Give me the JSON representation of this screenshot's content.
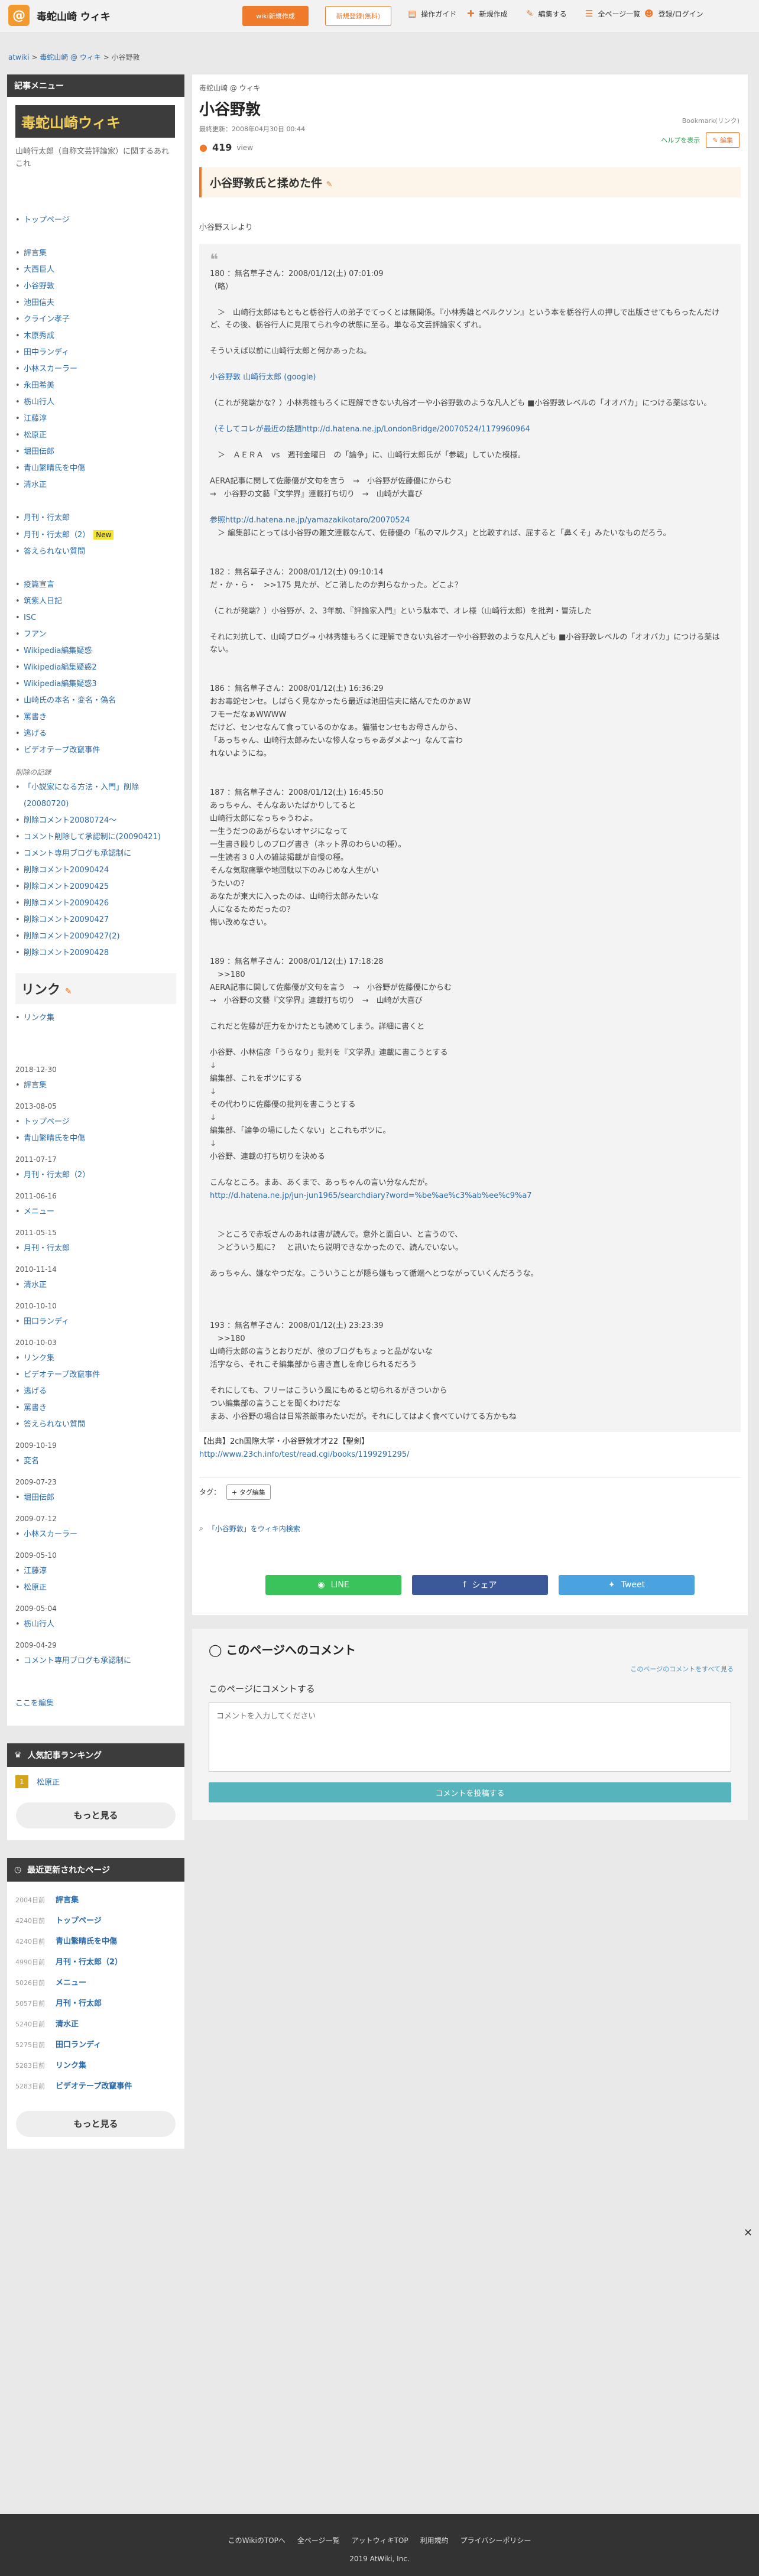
{
  "topbar": {
    "logo_letter": "@",
    "site_title": "毒蛇山崎 ウィキ",
    "wiki_button": "wiki新規作成",
    "login_button": "新規登録(無料)",
    "nav": [
      "操作ガイド",
      "新規作成",
      "編集する",
      "全ページ一覧",
      "登録/ログイン"
    ]
  },
  "breadcrumb": [
    "atwiki",
    "毒蛇山崎 @ ウィキ",
    "小谷野敦"
  ],
  "sidebar": {
    "menu_head": "記事メニュー",
    "wiki_title": "毒蛇山崎ウィキ",
    "desc": "山崎行太郎（自称文芸評論家）に関するあれこれ",
    "nav1": [
      "トップページ"
    ],
    "nav2": [
      "評言集",
      "大西巨人",
      "小谷野敦",
      "池田信夫",
      "クライン孝子",
      "木原秀成",
      "田中ランディ",
      "小林スカーラー",
      "永田希美",
      "栃山行人",
      "江藤淳",
      "松原正",
      "堀田伝郎",
      "青山繁晴氏を中傷",
      "清水正"
    ],
    "nav3": [
      "月刊・行太郎",
      "月刊・行太郎（2）",
      "答えられない質問"
    ],
    "new_badge": "New",
    "nav4": [
      "疫篇宣言",
      "筑紫人日記",
      "ISC",
      "フアン",
      "Wikipedia編集疑惑",
      "Wikipedia編集疑惑2",
      "Wikipedia編集疑惑3",
      "山崎氏の本名・変名・偽名",
      "罵書き",
      "逃げる",
      "ビデオテープ改竄事件"
    ],
    "deleted_head": "削除の記録",
    "nav5": [
      "「小説家になる方法・入門」削除(20080720)",
      "削除コメント20080724〜",
      "コメント削除して承認制に(20090421)",
      "コメント専用ブログも承認制に",
      "削除コメント20090424",
      "削除コメント20090425",
      "削除コメント20090426",
      "削除コメント20090427",
      "削除コメント20090427(2)",
      "削除コメント20090428"
    ],
    "links_title": "リンク",
    "links": [
      "リンク集"
    ],
    "history": [
      {
        "date": "2018-12-30",
        "items": [
          "評言集"
        ]
      },
      {
        "date": "2013-08-05",
        "items": [
          "トップページ",
          "青山繁晴氏を中傷"
        ]
      },
      {
        "date": "2011-07-17",
        "items": [
          "月刊・行太郎（2）"
        ]
      },
      {
        "date": "2011-06-16",
        "items": [
          "メニュー"
        ]
      },
      {
        "date": "2011-05-15",
        "items": [
          "月刊・行太郎"
        ]
      },
      {
        "date": "2010-11-14",
        "items": [
          "清水正"
        ]
      },
      {
        "date": "2010-10-10",
        "items": [
          "田口ランディ"
        ]
      },
      {
        "date": "2010-10-03",
        "items": [
          "リンク集",
          "ビデオテープ改竄事件",
          "逃げる",
          "罵書き",
          "答えられない質問"
        ]
      },
      {
        "date": "2009-10-19",
        "items": [
          "変名"
        ]
      },
      {
        "date": "2009-07-23",
        "items": [
          "堀田伝郎"
        ]
      },
      {
        "date": "2009-07-12",
        "items": [
          "小林スカーラー"
        ]
      },
      {
        "date": "2009-05-10",
        "items": [
          "江藤淳",
          "松原正"
        ]
      },
      {
        "date": "2009-05-04",
        "items": [
          "栃山行人"
        ]
      },
      {
        "date": "2009-04-29",
        "items": [
          "コメント専用ブログも承認制に"
        ]
      }
    ],
    "edit_here": "ここを編集",
    "rank_head": "人気記事ランキング",
    "rank": [
      {
        "num": "1",
        "title": "松原正"
      }
    ],
    "more": "もっと見る",
    "recent_head": "最近更新されたページ",
    "recent": [
      {
        "ago": "2004日前",
        "title": "評言集"
      },
      {
        "ago": "4240日前",
        "title": "トップページ"
      },
      {
        "ago": "4240日前",
        "title": "青山繁晴氏を中傷"
      },
      {
        "ago": "4990日前",
        "title": "月刊・行太郎（2）"
      },
      {
        "ago": "5026日前",
        "title": "メニュー"
      },
      {
        "ago": "5057日前",
        "title": "月刊・行太郎"
      },
      {
        "ago": "5240日前",
        "title": "清水正"
      },
      {
        "ago": "5275日前",
        "title": "田口ランディ"
      },
      {
        "ago": "5283日前",
        "title": "リンク集"
      },
      {
        "ago": "5283日前",
        "title": "ビデオテープ改竄事件"
      }
    ],
    "more2": "もっと見る"
  },
  "page": {
    "sub": "毒蛇山崎 @ ウィキ",
    "title": "小谷野敦",
    "updated": "最終更新：2008年04月30日 00:44",
    "views": "419",
    "views_label": "view",
    "meta": "Bookmark(リンク)",
    "help": "ヘルプを表示",
    "edit": "編集",
    "section_title": "小谷野敦氏と揉めた件",
    "intro": "小谷野スレより",
    "quote": [
      "180 ：無名草子さん：2008/01/12(土) 07:01:09",
      "（略）",
      "",
      "　＞　山崎行太郎はもともと栃谷行人の弟子でてっくとは無関係。『小林秀雄とベルクソン』という本を栃谷行人の押しで出版させてもらったんだけど、その後、栃谷行人に見限てられ今の状態に至る。単なる文芸評論家くずれ。",
      "",
      "そういえば以前に山崎行太郎と何かあったね。",
      "",
      "小谷野敦 山崎行太郎 (google)",
      "",
      "（これが発端かな？）小林秀雄もろくに理解できない丸谷才一や小谷野敦のような凡人ども ■小谷野敦レベルの「オオバカ」につける薬はない。",
      "",
      "（そしてコレが最近の話題http://d.hatena.ne.jp/LondonBridge/20070524/1179960964",
      "",
      "　＞　ＡＥＲＡ　vs　週刊金曜日　の「論争」に、山崎行太郎氏が「参戦」していた模様。",
      "",
      "AERA記事に関して佐藤優が文句を言う　→　小谷野が佐藤優にからむ",
      "→　小谷野の文藝『文学界』連載打ち切り　→　山崎が大喜び",
      "",
      "参照http://d.hatena.ne.jp/yamazakikotaro/20070524",
      "　＞ 編集部にとっては小谷野の難文連載なんて、佐藤優の「私のマルクス」と比較すれば、屁すると「鼻くそ」みたいなものだろう。",
      "",
      "",
      "182 ：無名草子さん：2008/01/12(土) 09:10:14",
      "だ・か・ら・　>>175 見たが、どこ消したのか判らなかった。どこよ？",
      "",
      "（これが発端？）小谷野が、2、3年前、『評論家入門』という駄本で、オレ様（山崎行太郎）を批判・冒涜した",
      "",
      "それに対抗して、山崎ブログ→ 小林秀雄もろくに理解できない丸谷才一や小谷野敦のような凡人ども ■小谷野敦レベルの「オオバカ」につける薬はない。",
      "",
      "",
      "186 ：無名草子さん：2008/01/12(土) 16:36:29",
      "おお毒蛇センセ。しばらく見なかったら最近は池田信夫に絡んでたのかぁW",
      "フモーだなぁWWWW",
      "だけど、センセなんて食っているのかなぁ。猫猫センセもお母さんから、",
      "「あっちゃん、山崎行太郎みたいな惨人なっちゃあダメよ～」なんて言わ",
      "れないようにね。",
      "",
      "",
      "187 ：無名草子さん：2008/01/12(土) 16:45:50",
      "あっちゃん、そんなあいたばかりしてると",
      "山崎行太郎になっちゃうわよ。",
      "一生うだつのあがらないオヤジになって",
      "一生書き殴りしのブログ書き（ネット界のわらいの種）。",
      "一生読者３０人の雑誌掲載が自慢の種。",
      "そんな気取痛撃や地団駄以下のみじめな人生がい",
      "うたいの？",
      "あなたが東大に入ったのは、山崎行太郎みたいな",
      "人になるためだったの？",
      "悔い改めなさい。",
      "",
      "",
      "189 ：無名草子さん：2008/01/12(土) 17:18:28",
      "　>>180",
      "AERA記事に関して佐藤優が文句を言う　→　小谷野が佐藤優にからむ",
      "→　小谷野の文藝『文学界』連載打ち切り　→　山崎が大喜び",
      "",
      "これだと佐藤が圧力をかけたとも読めてしまう。詳細に書くと",
      "",
      "小谷野、小林信彦「うらなり」批判を『文学界』連載に書こうとする",
      "↓",
      "編集部、これをボツにする",
      "↓",
      "その代わりに佐藤優の批判を書こうとする",
      "↓",
      "編集部、「論争の場にしたくない」とこれもボツに。",
      "↓",
      "小谷野、連載の打ち切りを決める",
      "",
      "こんなところ。まあ、あくまで、あっちゃんの言い分なんだが。",
      "http://d.hatena.ne.jp/jun-jun1965/searchdiary?word=%be%ae%c3%ab%ee%c9%a7",
      "",
      "",
      "　＞ところで赤坂さんのあれは書が読んで。意外と面白い、と言うので、",
      "　＞どういう風に？　と訊いたら説明できなかったので、読んでいない。",
      "",
      "あっちゃん、嫌なやつだな。こういうことが隠ら嫌もって循端へとつながっていくんだろうな。",
      "",
      "",
      "",
      "193 ：無名草子さん：2008/01/12(土) 23:23:39",
      "　>>180",
      "山崎行太郎の言うとおりだが、彼のブログもちょっと品がないな",
      "活字なら、それこそ編集部から書き直しを命じられるだろう",
      "",
      "それにしても、フリーはこういう風にもめると切られるがきついから",
      "つい編集部の言うことを聞くわけだな",
      "まあ、小谷野の場合は日常茶飯事みたいだが。それにしてはよく食べていけてる方かもね"
    ],
    "source_line": "【出典】2ch国際大学・小谷野敦才才22【聖剣】",
    "source_url": "http://www.23ch.info/test/read.cgi/books/1199291295/",
    "tags_label": "タグ：",
    "tag_edit": "+ タグ編集",
    "search_text": "「小谷野敦」をウィキ内検索",
    "share": {
      "line": "LINE",
      "facebook": "シェア",
      "twitter": "Tweet"
    }
  },
  "comments": {
    "title": "このページへのコメント",
    "see_all": "このページのコメントをすべて見る",
    "label": "このページにコメントする",
    "placeholder": "コメントを入力してください",
    "post": "コメントを投稿する"
  },
  "footer": {
    "links": [
      "このWikiのTOPへ",
      "全ページ一覧",
      "アットウィキTOP",
      "利用規約",
      "プライバシーポリシー"
    ],
    "copy": "2019 AtWiki, Inc."
  },
  "colors": {
    "accent": "#f07a2c",
    "dark": "#3c3c3c",
    "line": "#3ac35a",
    "facebook": "#3b5998",
    "twitter": "#4aa3df"
  }
}
